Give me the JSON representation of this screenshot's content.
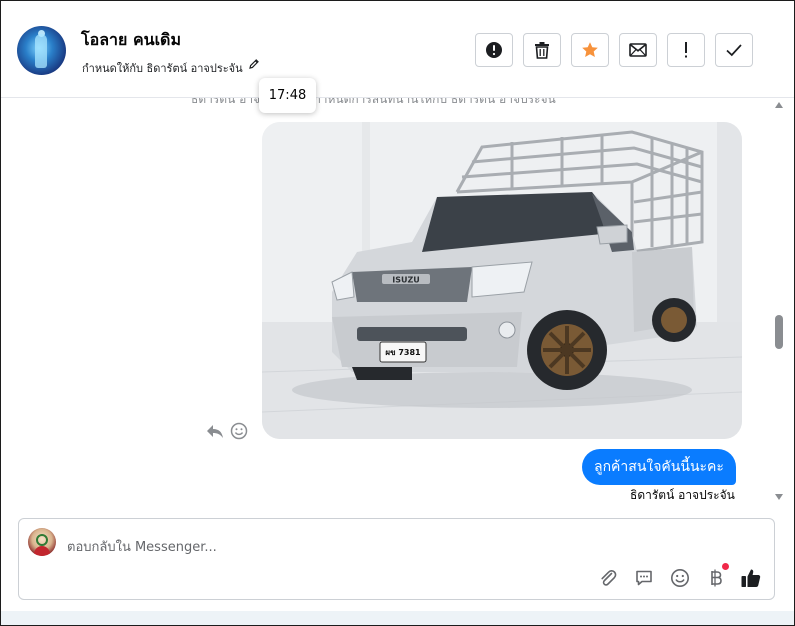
{
  "header": {
    "name": "โอลาย คนเดิม",
    "assign_text": "กำหนดให้กับ ธิดารัตน์ อาจประจัน",
    "tooltip_time": "17:48",
    "actions": [
      {
        "id": "spam",
        "icon": "alert-circle-icon"
      },
      {
        "id": "delete",
        "icon": "trash-icon"
      },
      {
        "id": "star",
        "icon": "star-icon"
      },
      {
        "id": "unread",
        "icon": "envelope-icon"
      },
      {
        "id": "follow-up",
        "icon": "exclamation-icon"
      },
      {
        "id": "done",
        "icon": "check-icon"
      }
    ]
  },
  "chat": {
    "system_text": "ธิดารัตน์ อาจประจัน ได้กำหนดการสนทนานี้ให้กับ ธิดารัตน์ อาจประจัน",
    "photo": {
      "plate": "ผข 7381",
      "brand": "ISUZU"
    },
    "message": "ลูกค้าสนใจคันนี้นะคะ",
    "sender": "ธิดารัตน์ อาจประจัน"
  },
  "composer": {
    "placeholder": "ตอบกลับใน Messenger...",
    "tools": [
      "paperclip-icon",
      "comment-icon",
      "smile-icon",
      "baht-icon",
      "thumbs-up-icon"
    ]
  },
  "colors": {
    "accent": "#0a7cff",
    "star": "#f7923b",
    "dot": "#f02849"
  }
}
